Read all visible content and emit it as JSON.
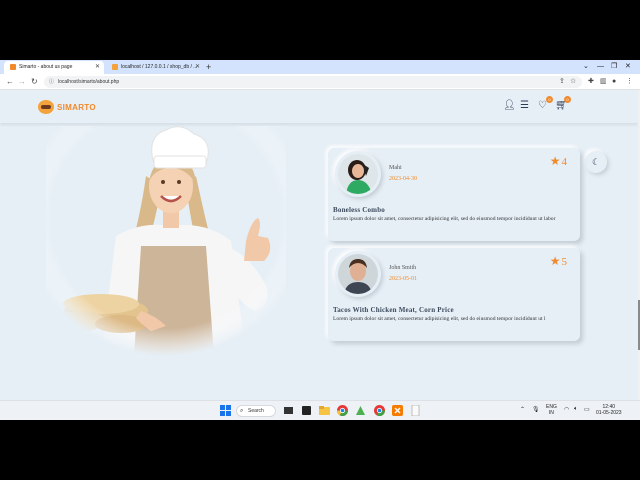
{
  "browser": {
    "tabs": [
      {
        "title": "Simarto - about us page",
        "color": "#f08a2c"
      },
      {
        "title": "localhost / 127.0.0.1 / shop_db / ...",
        "color": "#f4a23c"
      }
    ],
    "url": "localhost/simarto/about.php"
  },
  "site": {
    "brand": "SIMARTO",
    "wishlist_count": "0",
    "cart_count": "0"
  },
  "reviews": [
    {
      "name": "Mahi",
      "date": "2023-04-30",
      "rating": "4",
      "dish": "Boneless Combo",
      "text": "Lorem ipsum dolor sit amet, consectetur adipisicing elit, sed do eiusmod tempor incididunt ut labor"
    },
    {
      "name": "John Smith",
      "date": "2023-05-01",
      "rating": "5",
      "dish": "Tacos With Chicken Meat, Corn Price",
      "text": "Lorem ipsum dolor sit amet, consectetur adipisicing elit, sed do eiusmod tempor incididunt ut l"
    }
  ],
  "taskbar": {
    "search_label": "Search",
    "lang_top": "ENG",
    "lang_bottom": "IN",
    "time": "12:40",
    "date": "01-05-2023"
  },
  "colors": {
    "accent": "#f08a2c",
    "page_bg": "#e6eff6",
    "tab_bar": "#d3e3fd"
  }
}
